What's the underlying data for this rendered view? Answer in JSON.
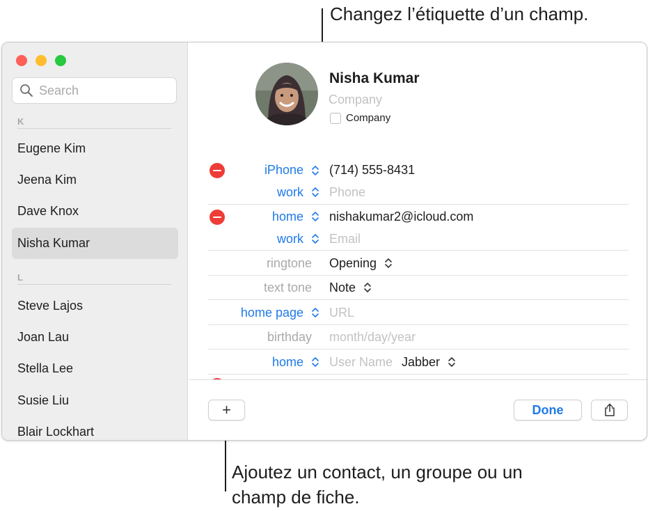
{
  "annotations": {
    "top": "Changez l’étiquette d’un champ.",
    "bottom": "Ajoutez un contact, un groupe ou un champ de fiche."
  },
  "sidebar": {
    "search_placeholder": "Search",
    "sections": [
      {
        "letter": "K",
        "contacts": [
          "Eugene Kim",
          "Jeena Kim",
          "Dave Knox",
          "Nisha Kumar"
        ]
      },
      {
        "letter": "L",
        "contacts": [
          "Steve Lajos",
          "Joan Lau",
          "Stella Lee",
          "Susie Liu",
          "Blair Lockhart"
        ]
      }
    ],
    "selected": "Nisha Kumar"
  },
  "card": {
    "name": "Nisha  Kumar",
    "company_placeholder": "Company",
    "company_checkbox_label": "Company",
    "phone": {
      "label": "iPhone",
      "value": "(714) 555-8431"
    },
    "phone_new": {
      "label": "work",
      "placeholder": "Phone"
    },
    "email": {
      "label": "home",
      "value": "nishakumar2@icloud.com"
    },
    "email_new": {
      "label": "work",
      "placeholder": "Email"
    },
    "ringtone": {
      "label": "ringtone",
      "value": "Opening"
    },
    "texttone": {
      "label": "text tone",
      "value": "Note"
    },
    "homepage": {
      "label": "home page",
      "placeholder": "URL"
    },
    "birthday": {
      "label": "birthday",
      "placeholder": "month/day/year"
    },
    "im": {
      "label": "home",
      "placeholder": "User Name",
      "service": "Jabber"
    }
  },
  "footer": {
    "add_label": "+",
    "done_label": "Done"
  },
  "colors": {
    "accent": "#1f7ae8",
    "remove": "#ee3c36"
  }
}
